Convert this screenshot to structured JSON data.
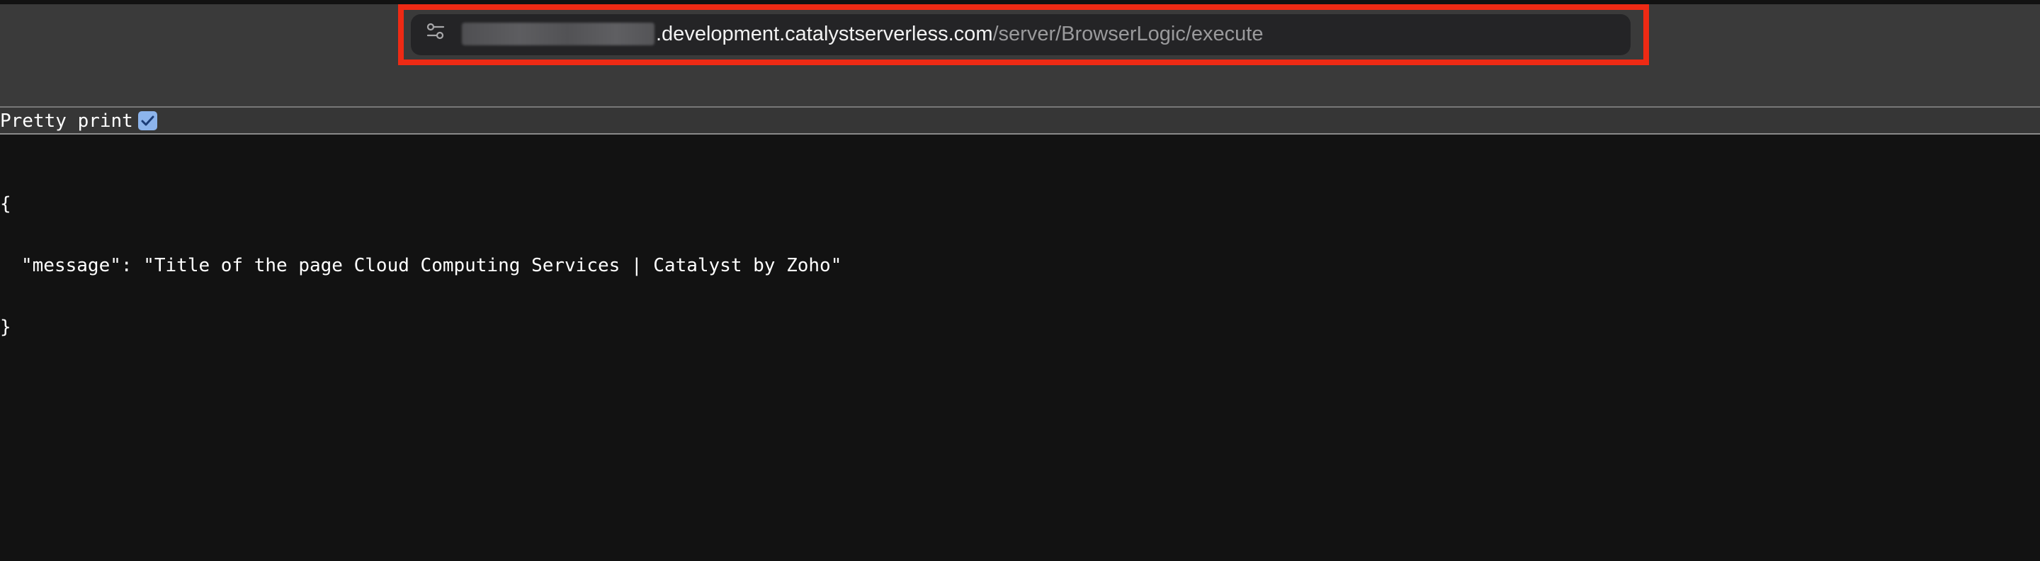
{
  "address_bar": {
    "url_host": ".development.catalystserverless.com",
    "url_path": "/server/BrowserLogic/execute"
  },
  "json_viewer": {
    "pretty_print_label": "Pretty print",
    "pretty_print_checked": true,
    "open_brace": "{",
    "key": "\"message\"",
    "colon": ": ",
    "value": "\"Title of the page Cloud Computing Services | Catalyst by Zoho\"",
    "close_brace": "}"
  },
  "colors": {
    "highlight_box": "#ee2a14",
    "toolbar_bg": "#3a3a3a",
    "page_bg": "#121212",
    "checkbox_accent": "#8cb4ec"
  },
  "icons": {
    "address_bar_left": "tune-sliders-icon",
    "checkbox_mark": "checkmark-icon"
  }
}
